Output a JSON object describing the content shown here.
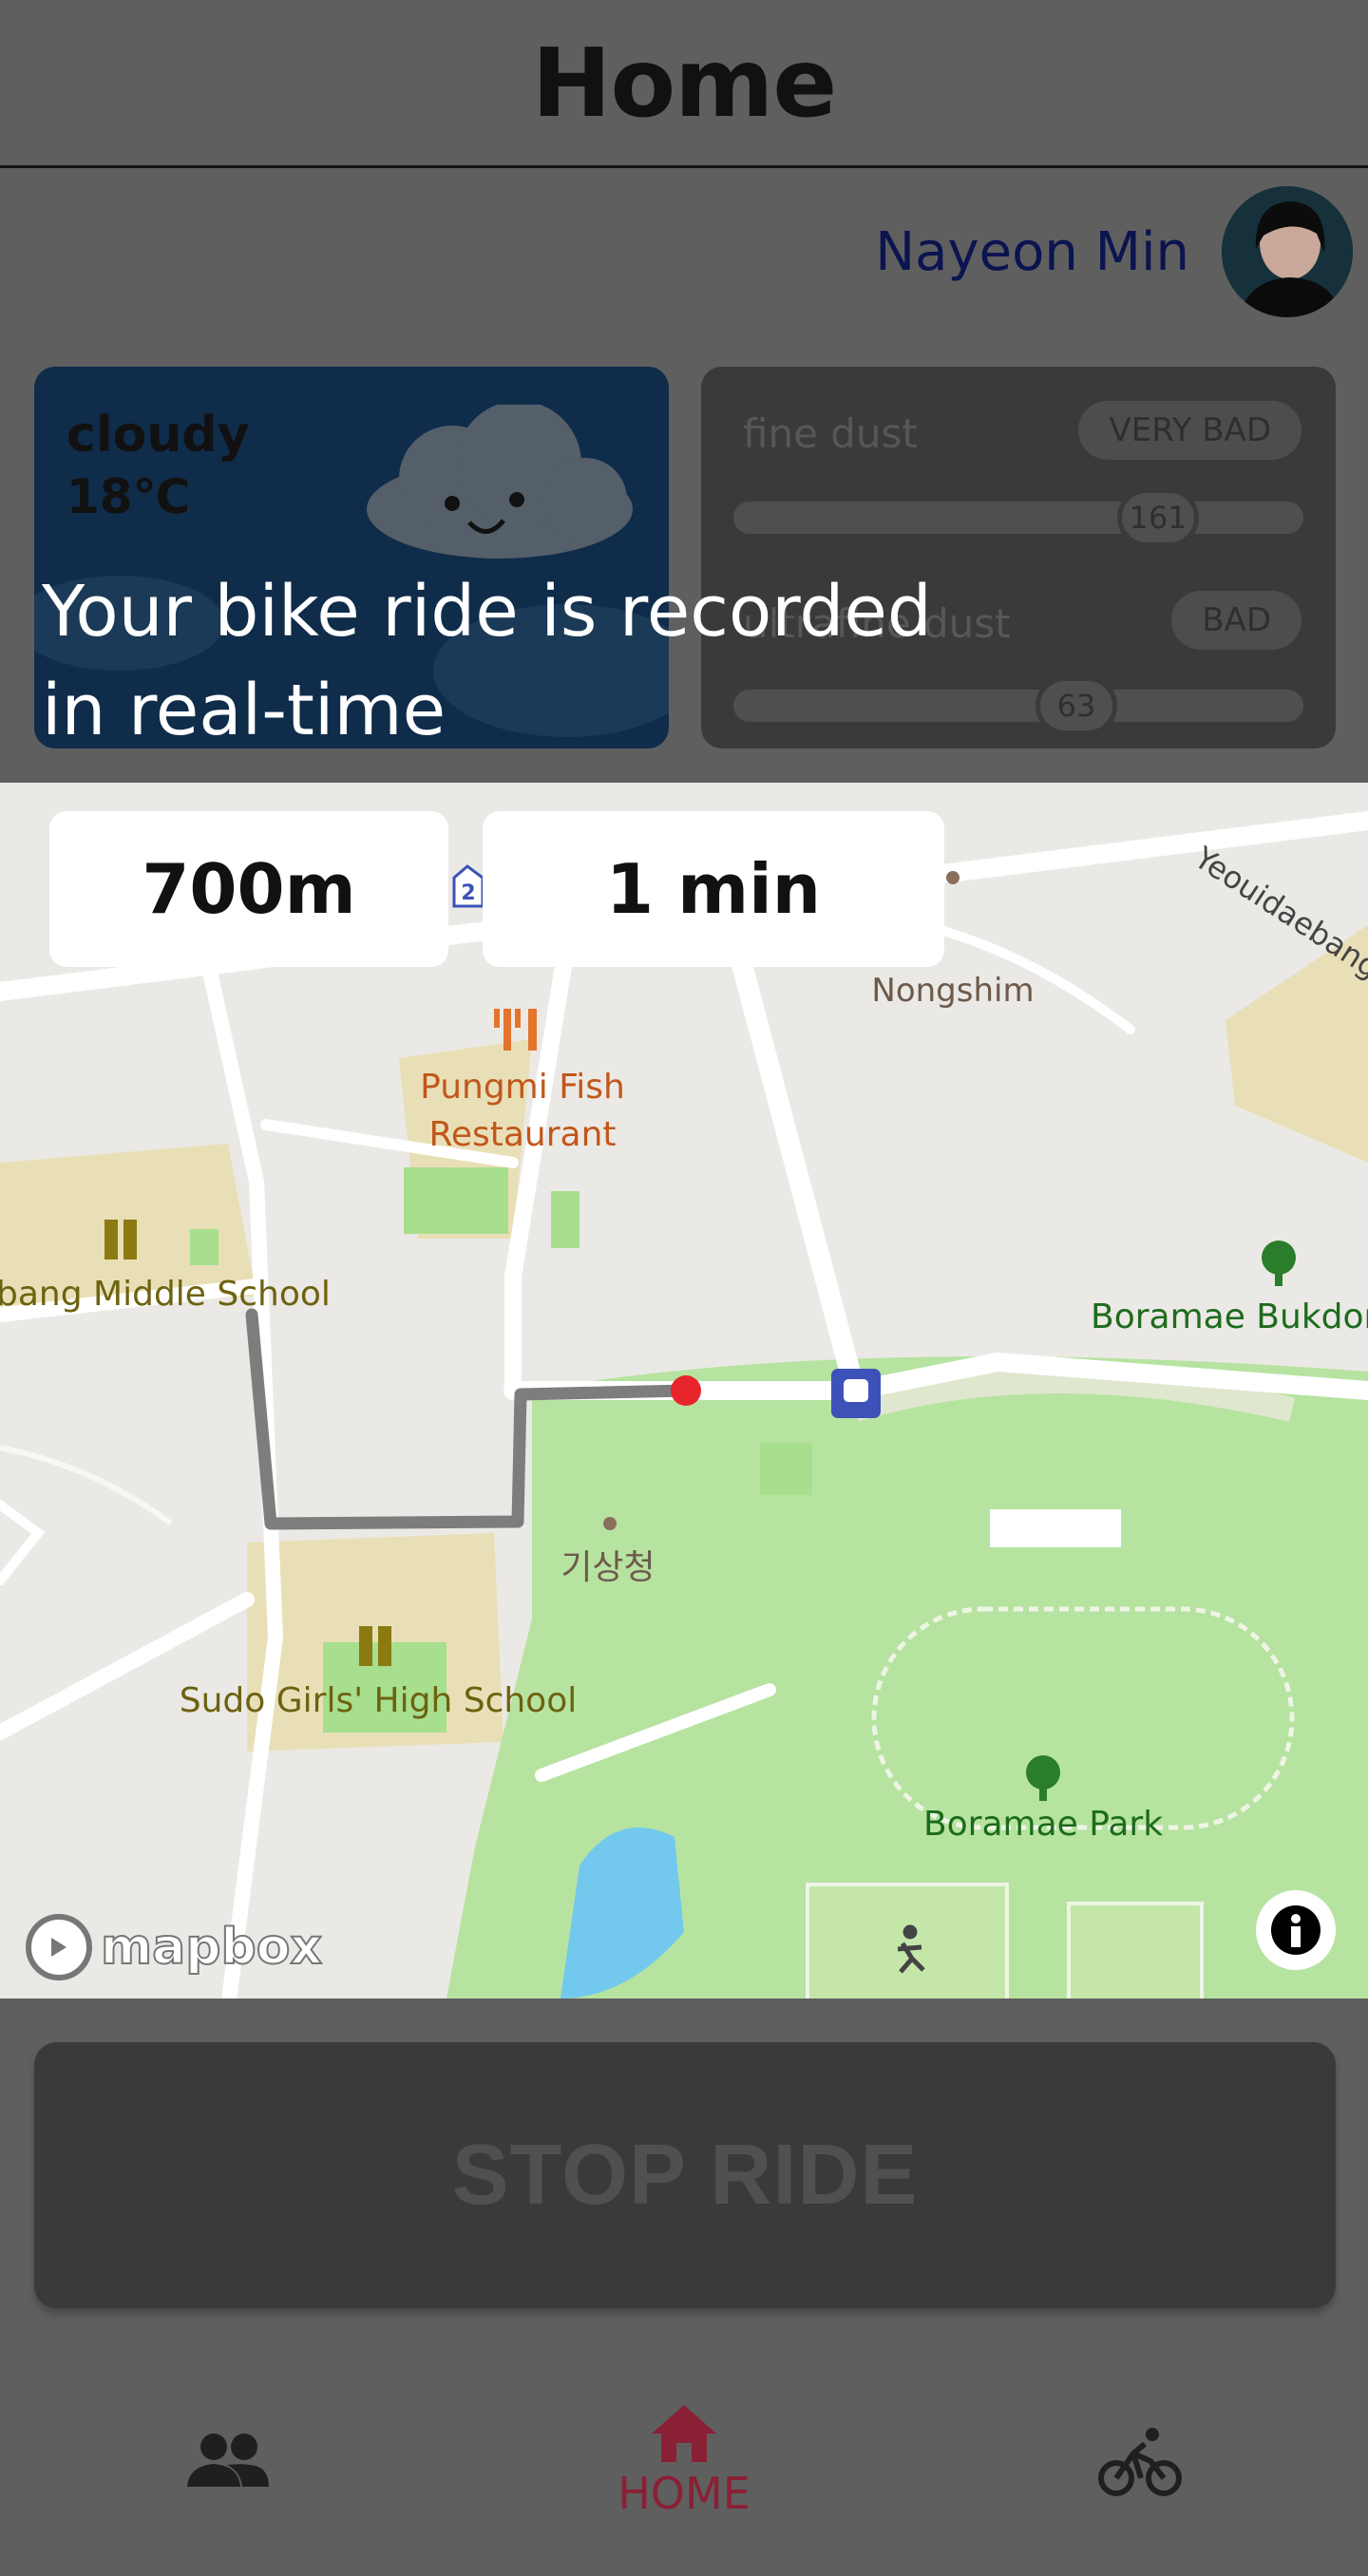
{
  "header": {
    "title": "Home"
  },
  "profile": {
    "name": "Nayeon Min"
  },
  "weather": {
    "condition": "cloudy",
    "temperature": "18℃"
  },
  "dust": {
    "fine": {
      "label": "fine dust",
      "status": "VERY BAD",
      "value": "161"
    },
    "ultrafine": {
      "label": "ultrafine dust",
      "status": "BAD",
      "value": "63"
    }
  },
  "overlay": {
    "line1": "Your bike ride is recorded",
    "line2": "in real-time"
  },
  "ride": {
    "distance": "700m",
    "duration": "1 min"
  },
  "map": {
    "labels": {
      "nongshim": "Nongshim",
      "road": "Yeouidaebang",
      "restaurant_1": "Pungmi Fish",
      "restaurant_2": "Restaurant",
      "middle_school": "bang Middle School",
      "bukdong": "Boramae Bukdon",
      "kma": "기상청",
      "girls_school": "Sudo Girls' High School",
      "park": "Boramae Park",
      "shield": "2",
      "attribution": "mapbox"
    }
  },
  "actions": {
    "stop_ride": "STOP RIDE"
  },
  "nav": {
    "home": "HOME"
  },
  "colors": {
    "accent": "#8a2035",
    "route": "#7d7d7d",
    "current_position": "#e8252b"
  }
}
